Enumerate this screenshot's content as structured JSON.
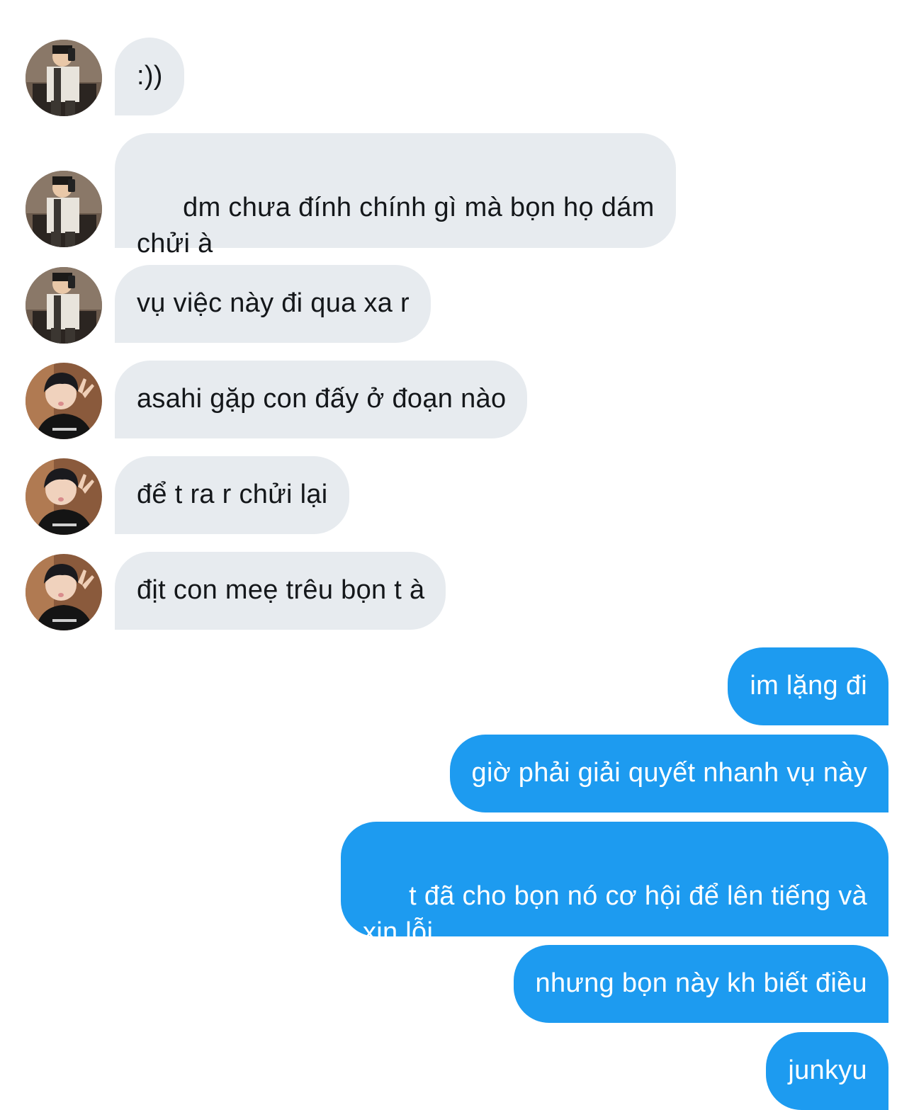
{
  "conversation": {
    "messages": [
      {
        "sender": "user_a",
        "text": ":))"
      },
      {
        "sender": "user_a",
        "text": "dm chưa đính chính gì mà bọn họ dám\nchửi à"
      },
      {
        "sender": "user_a",
        "text": "vụ việc này đi qua xa r"
      },
      {
        "sender": "user_b",
        "text": "asahi gặp con đấy ở đoạn nào"
      },
      {
        "sender": "user_b",
        "text": "để t ra r chửi lại"
      },
      {
        "sender": "user_b",
        "text": "địt con meẹ trêu bọn t à"
      },
      {
        "sender": "me",
        "text": "im lặng đi"
      },
      {
        "sender": "me",
        "text": "giờ phải giải quyết nhanh vụ này"
      },
      {
        "sender": "me",
        "text": "t đã cho bọn nó cơ hội để lên tiếng và\nxin lỗi"
      },
      {
        "sender": "me",
        "text": "nhưng bọn này kh biết điều"
      },
      {
        "sender": "me",
        "text": "junkyu"
      }
    ]
  },
  "colors": {
    "incoming_bubble": "#e7ebef",
    "incoming_text": "#14171a",
    "outgoing_bubble": "#1d9bf0",
    "outgoing_text": "#ffffff",
    "background": "#ffffff"
  },
  "icons": {
    "user_a_avatar": "avatar-mirror-selfie-icon",
    "user_b_avatar": "avatar-peace-sign-icon"
  }
}
